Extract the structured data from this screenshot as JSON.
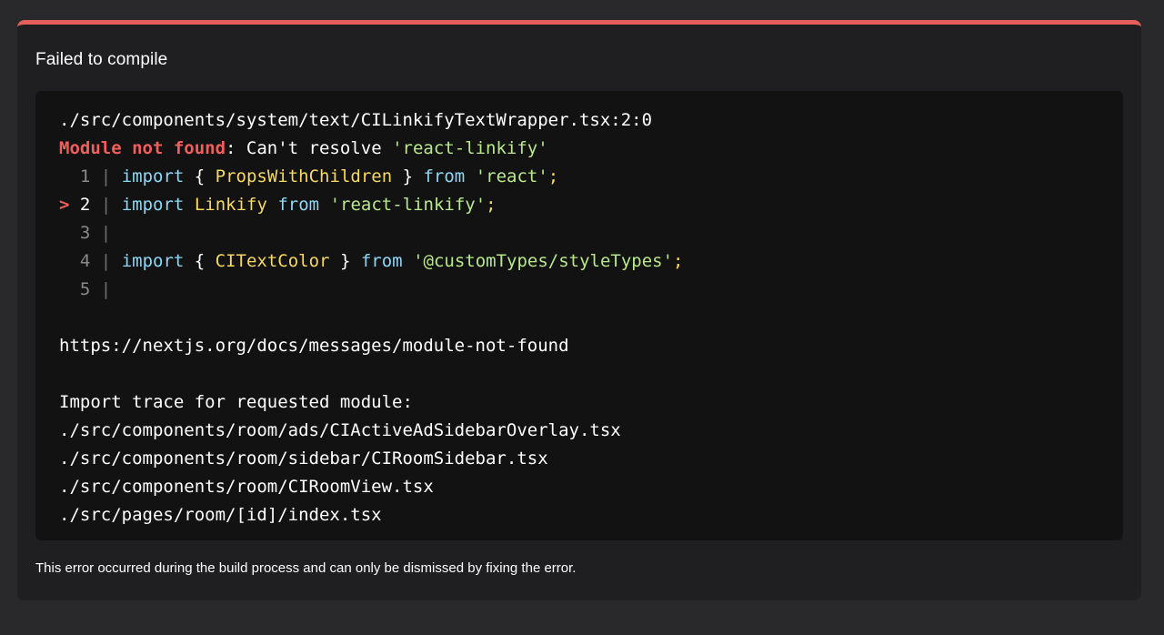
{
  "overlay": {
    "title": "Failed to compile",
    "footer": "This error occurred during the build process and can only be dismissed by fixing the error.",
    "accent_color": "#e5605a"
  },
  "error": {
    "file_path": "./src/components/system/text/CILinkifyTextWrapper.tsx:2:0",
    "type": "Module not found",
    "colon": ":",
    "message": " Can't resolve ",
    "module": "'react-linkify'"
  },
  "code_frame": {
    "line1": {
      "num": "1",
      "import": "import",
      "open": " { ",
      "name": "PropsWithChildren",
      "close": " } ",
      "from": "from",
      "space": " ",
      "source": "'react'",
      "semi": ";"
    },
    "line2": {
      "marker": ">",
      "num": "2",
      "import": "import",
      "name": "Linkify",
      "from": "from",
      "source": "'react-linkify'",
      "semi": ";"
    },
    "line3": {
      "num": "3"
    },
    "line4": {
      "num": "4",
      "import": "import",
      "open": " { ",
      "name": "CITextColor",
      "close": " } ",
      "from": "from",
      "source": "'@customTypes/styleTypes'",
      "semi": ";"
    },
    "line5": {
      "num": "5"
    },
    "pipe": "|"
  },
  "docs_link": "https://nextjs.org/docs/messages/module-not-found",
  "trace": {
    "heading": "Import trace for requested module:",
    "items": [
      "./src/components/room/ads/CIActiveAdSidebarOverlay.tsx",
      "./src/components/room/sidebar/CIRoomSidebar.tsx",
      "./src/components/room/CIRoomView.tsx",
      "./src/pages/room/[id]/index.tsx"
    ]
  }
}
